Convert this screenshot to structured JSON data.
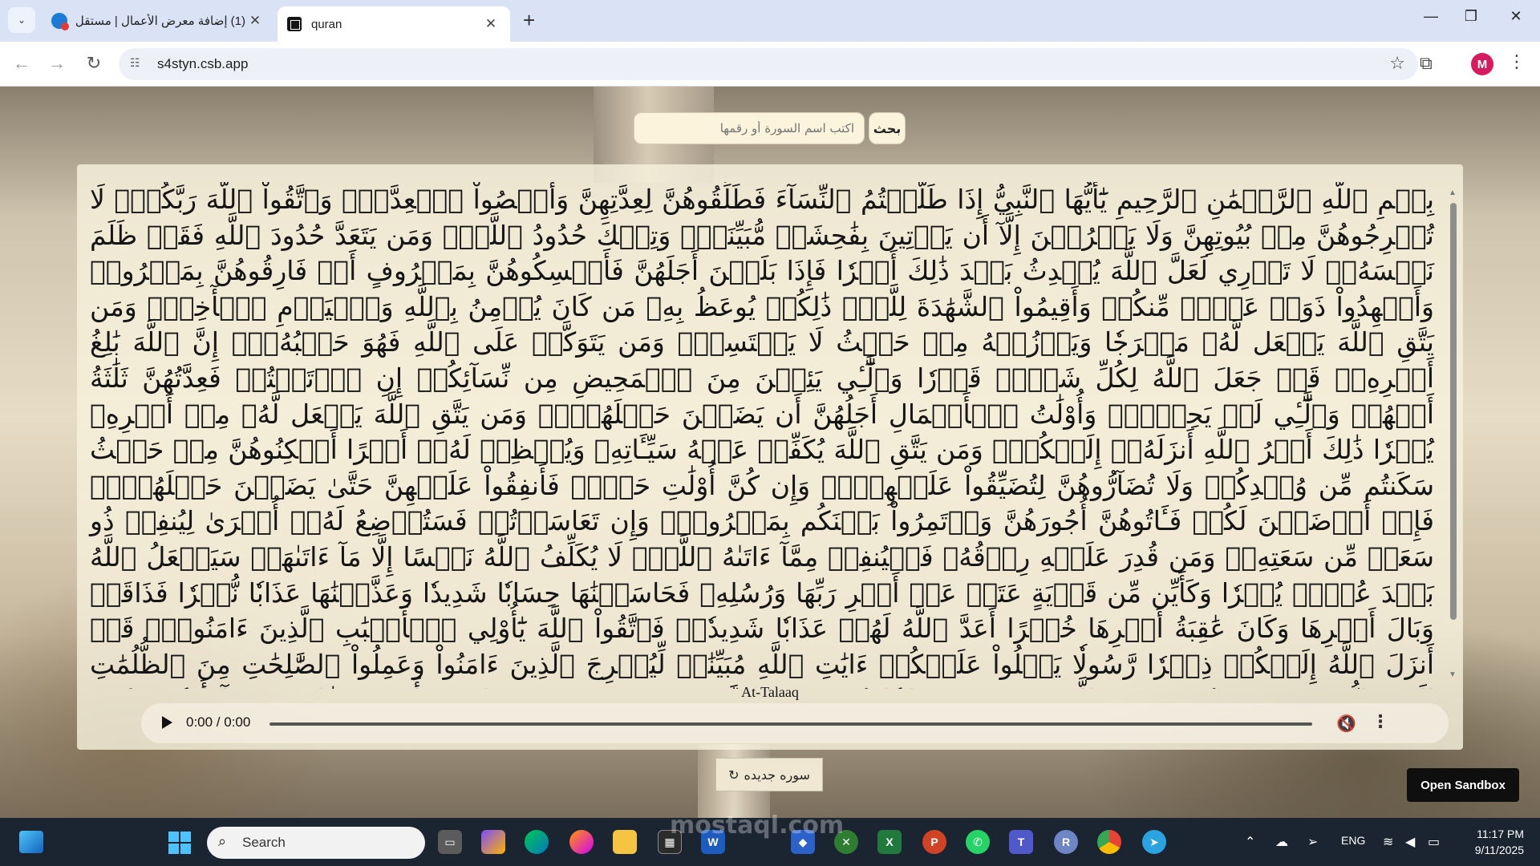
{
  "browser": {
    "tabs": [
      {
        "title": "(1) إضافة معرض الأعمال | مستقل",
        "active": false
      },
      {
        "title": "quran",
        "active": true
      }
    ],
    "url": "s4styn.csb.app",
    "profile_initial": "M"
  },
  "page": {
    "search": {
      "placeholder": "اكتب اسم السورة أو رقمها",
      "button_label": "بحث"
    },
    "verses_text": "بِسۡمِ ٱللَّهِ ٱلرَّحۡمَٰنِ ٱلرَّحِيمِ يَٰٓأَيُّهَا ٱلنَّبِيُّ إِذَا طَلَّقۡتُمُ ٱلنِّسَآءَ فَطَلِّقُوهُنَّ لِعِدَّتِهِنَّ وَأَحۡصُواْ ٱلۡعِدَّةَۖ وَٱتَّقُواْ ٱللَّهَ رَبَّكُمۡۖ لَا تُخۡرِجُوهُنَّ مِنۢ بُيُوتِهِنَّ وَلَا يَخۡرُجۡنَ إِلَّآ أَن يَأۡتِينَ بِفَٰحِشَةٖ مُّبَيِّنَةٖۚ وَتِلۡكَ حُدُودُ ٱللَّهِۚ وَمَن يَتَعَدَّ حُدُودَ ٱللَّهِ فَقَدۡ ظَلَمَ نَفۡسَهُۥۚ لَا تَدۡرِي لَعَلَّ ٱللَّهَ يُحۡدِثُ بَعۡدَ ذَٰلِكَ أَمۡرٗا فَإِذَا بَلَغۡنَ أَجَلَهُنَّ فَأَمۡسِكُوهُنَّ بِمَعۡرُوفٍ أَوۡ فَارِقُوهُنَّ بِمَعۡرُوفٖ وَأَشۡهِدُواْ ذَوَيۡ عَدۡلٖ مِّنكُمۡ وَأَقِيمُواْ ٱلشَّهَٰدَةَ لِلَّهِۚ ذَٰلِكُمۡ يُوعَظُ بِهِۦ مَن كَانَ يُؤۡمِنُ بِٱللَّهِ وَٱلۡيَوۡمِ ٱلۡأٓخِرِۚ وَمَن يَتَّقِ ٱللَّهَ يَجۡعَل لَّهُۥ مَخۡرَجٗا وَيَرۡزُقۡهُ مِنۡ حَيۡثُ لَا يَحۡتَسِبُۚ وَمَن يَتَوَكَّلۡ عَلَى ٱللَّهِ فَهُوَ حَسۡبُهُۥٓۚ إِنَّ ٱللَّهَ بَٰلِغُ أَمۡرِهِۦۚ قَدۡ جَعَلَ ٱللَّهُ لِكُلِّ شَيۡءٖ قَدۡرٗا وَٱلَّٰٓـِٔي يَئِسۡنَ مِنَ ٱلۡمَحِيضِ مِن نِّسَآئِكُمۡ إِنِ ٱرۡتَبۡتُمۡ فَعِدَّتُهُنَّ ثَلَٰثَةُ أَشۡهُرٖ وَٱلَّٰٓـِٔي لَمۡ يَحِضۡنَۚ وَأُوْلَٰتُ ٱلۡأَحۡمَالِ أَجَلُهُنَّ أَن يَضَعۡنَ حَمۡلَهُنَّۚ وَمَن يَتَّقِ ٱللَّهَ يَجۡعَل لَّهُۥ مِنۡ أَمۡرِهِۦ يُسۡرٗا ذَٰلِكَ أَمۡرُ ٱللَّهِ أَنزَلَهُۥٓ إِلَيۡكُمۡۚ وَمَن يَتَّقِ ٱللَّهَ يُكَفِّرۡ عَنۡهُ سَيِّـَٔاتِهِۦ وَيُعۡظِمۡ لَهُۥٓ أَجۡرًا أَسۡكِنُوهُنَّ مِنۡ حَيۡثُ سَكَنتُم مِّن وُجۡدِكُمۡ وَلَا تُضَآرُّوهُنَّ لِتُضَيِّقُواْ عَلَيۡهِنَّۚ وَإِن كُنَّ أُوْلَٰتِ حَمۡلٖ فَأَنفِقُواْ عَلَيۡهِنَّ حَتَّىٰ يَضَعۡنَ حَمۡلَهُنَّۚ فَإِنۡ أَرۡضَعۡنَ لَكُمۡ فَـَٔاتُوهُنَّ أُجُورَهُنَّ وَأۡتَمِرُواْ بَيۡنَكُم بِمَعۡرُوفٖۖ وَإِن تَعَاسَرۡتُمۡ فَسَتُرۡضِعُ لَهُۥٓ أُخۡرَىٰ لِيُنفِقۡ ذُو سَعَةٖ مِّن سَعَتِهِۦۖ وَمَن قُدِرَ عَلَيۡهِ رِزۡقُهُۥ فَلۡيُنفِقۡ مِمَّآ ءَاتَىٰهُ ٱللَّهُۚ لَا يُكَلِّفُ ٱللَّهُ نَفۡسًا إِلَّا مَآ ءَاتَىٰهَاۚ سَيَجۡعَلُ ٱللَّهُ بَعۡدَ عُسۡرٖ يُسۡرٗا وَكَأَيِّن مِّن قَرۡيَةٍ عَتَتۡ عَنۡ أَمۡرِ رَبِّهَا وَرُسُلِهِۦ فَحَاسَبۡنَٰهَا حِسَابٗا شَدِيدٗا وَعَذَّبۡنَٰهَا عَذَابٗا نُّكۡرٗا فَذَاقَتۡ وَبَالَ أَمۡرِهَا وَكَانَ عَٰقِبَةُ أَمۡرِهَا خُسۡرًا أَعَدَّ ٱللَّهُ لَهُمۡ عَذَابٗا شَدِيدٗاۖ فَٱتَّقُواْ ٱللَّهَ يَٰٓأُوْلِي ٱلۡأَلۡبَٰبِ ٱلَّذِينَ ءَامَنُواْۚ قَدۡ أَنزَلَ ٱللَّهُ إِلَيۡكُمۡ ذِكۡرٗا رَّسُولٗا يَتۡلُواْ عَلَيۡكُمۡ ءَايَٰتِ ٱللَّهِ مُبَيِّنَٰتٖ لِّيُخۡرِجَ ٱلَّذِينَ ءَامَنُواْ وَعَمِلُواْ ٱلصَّٰلِحَٰتِ مِنَ ٱلظُّلُمَٰتِ إِلَى ٱلنُّورِۚ وَمَن يُؤۡمِنۢ بِٱللَّهِ وَيَعۡمَلۡ صَٰلِحٗا يُدۡخِلۡهُ جَنَّٰتٖ تَجۡرِي مِن تَحۡتِهَا ٱلۡأَنۡهَٰرُ خَٰلِدِينَ فِيهَآ أَبَدٗاۖ قَدۡ أَحۡسَنَ ٱللَّهُ لَهُۥ رِزۡقًا ٱللَّهُ ٱلَّذِي خَلَقَ سَبۡعَ سَمَٰوَٰتٖ وَمِنَ ٱلۡأَرۡضِ مِثۡلَهُنَّۖ يَتَنَزَّلُ ٱلۡأَمۡرُ بَيۡنَهُنَّ لِتَعۡلَمُوٓاْ أَنَّ ٱللَّهَ عَلَىٰ كُلِّ شَيۡءٖ قَدِيرٞ وَأَنَّ ٱللَّهَ قَدۡ أَحَاطَ بِكُلِّ شَيۡءٍ عِلۡمَۢا",
    "surah_name": "At-Talaaq",
    "audio": {
      "time": "0:00 / 0:00"
    },
    "new_surah_label": "سوره جديده",
    "new_surah_icon": "↻",
    "open_sandbox_label": "Open Sandbox"
  },
  "taskbar": {
    "search_placeholder": "Search",
    "language": "ENG",
    "time": "11:17 PM",
    "date": "9/11/2025"
  },
  "watermark": "mostaql.com",
  "colors": {
    "card_bg": "#f7f0dc",
    "chrome_tab_bg": "#d9e3f5",
    "taskbar_bg": "#1b2431"
  }
}
